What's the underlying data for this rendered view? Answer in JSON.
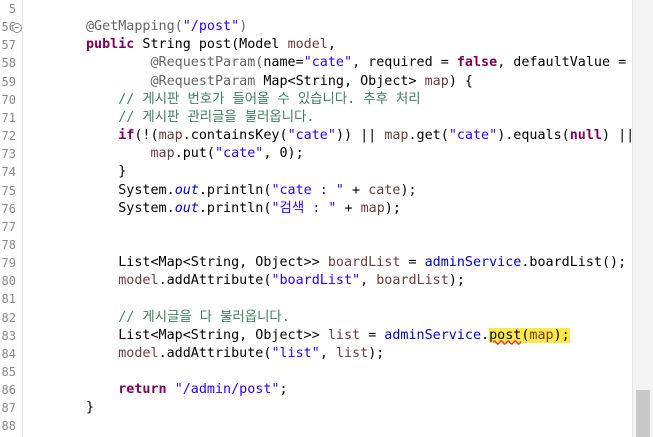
{
  "editor": {
    "line_numbers": [
      "5",
      "56",
      "57",
      "58",
      "59",
      "70",
      "71",
      "72",
      "73",
      "74",
      "75",
      "76",
      "77",
      "78",
      "79",
      "80",
      "81",
      "82",
      "83",
      "84",
      "85",
      "86",
      "87",
      "88"
    ],
    "fold_marker": "−",
    "highlight_color": "#ffe94a",
    "lines": [
      [],
      [
        {
          "t": "@GetMapping(",
          "c": "ann"
        },
        {
          "t": "\"/post\"",
          "c": "str"
        },
        {
          "t": ")",
          "c": "ann"
        }
      ],
      [
        {
          "t": "public",
          "c": "kw"
        },
        {
          "t": " String post(Model "
        },
        {
          "t": "model",
          "c": "var"
        },
        {
          "t": ","
        }
      ],
      [
        {
          "t": "        "
        },
        {
          "t": "@RequestParam(",
          "c": "ann"
        },
        {
          "t": "name="
        },
        {
          "t": "\"cate\"",
          "c": "str"
        },
        {
          "t": ", required = "
        },
        {
          "t": "false",
          "c": "kw"
        },
        {
          "t": ", defaultValue = "
        }
      ],
      [
        {
          "t": "        "
        },
        {
          "t": "@RequestParam",
          "c": "ann"
        },
        {
          "t": " Map<String, Object> "
        },
        {
          "t": "map",
          "c": "var"
        },
        {
          "t": ") {"
        }
      ],
      [
        {
          "t": "    "
        },
        {
          "t": "// 게시판 번호가 들어올 수 있습니다. 추후 처리",
          "c": "cmt"
        }
      ],
      [
        {
          "t": "    "
        },
        {
          "t": "// 게시판 관리글을 불러옵니다.",
          "c": "cmt"
        }
      ],
      [
        {
          "t": "    "
        },
        {
          "t": "if",
          "c": "kw"
        },
        {
          "t": "(!("
        },
        {
          "t": "map",
          "c": "var"
        },
        {
          "t": ".containsKey("
        },
        {
          "t": "\"cate\"",
          "c": "str"
        },
        {
          "t": ")) || "
        },
        {
          "t": "map",
          "c": "var"
        },
        {
          "t": ".get("
        },
        {
          "t": "\"cate\"",
          "c": "str"
        },
        {
          "t": ").equals("
        },
        {
          "t": "null",
          "c": "kw"
        },
        {
          "t": ") ||"
        }
      ],
      [
        {
          "t": "        "
        },
        {
          "t": "map",
          "c": "var"
        },
        {
          "t": ".put("
        },
        {
          "t": "\"cate\"",
          "c": "str"
        },
        {
          "t": ", 0);"
        }
      ],
      [
        {
          "t": "    }"
        }
      ],
      [
        {
          "t": "    System."
        },
        {
          "t": "out",
          "c": "fld"
        },
        {
          "t": ".println("
        },
        {
          "t": "\"cate : \"",
          "c": "str"
        },
        {
          "t": " + "
        },
        {
          "t": "cate",
          "c": "var"
        },
        {
          "t": ");"
        }
      ],
      [
        {
          "t": "    System."
        },
        {
          "t": "out",
          "c": "fld"
        },
        {
          "t": ".println("
        },
        {
          "t": "\"검색 : \"",
          "c": "str"
        },
        {
          "t": " + "
        },
        {
          "t": "map",
          "c": "var"
        },
        {
          "t": ");"
        }
      ],
      [],
      [],
      [
        {
          "t": "    List<Map<String, Object>> "
        },
        {
          "t": "boardList",
          "c": "var"
        },
        {
          "t": " = "
        },
        {
          "t": "adminService",
          "c": "fld2"
        },
        {
          "t": ".boardList();"
        }
      ],
      [
        {
          "t": "    "
        },
        {
          "t": "model",
          "c": "var"
        },
        {
          "t": ".addAttribute("
        },
        {
          "t": "\"boardList\"",
          "c": "str"
        },
        {
          "t": ", "
        },
        {
          "t": "boardList",
          "c": "var"
        },
        {
          "t": ");"
        }
      ],
      [],
      [
        {
          "t": "    "
        },
        {
          "t": "// 게시글을 다 불러옵니다.",
          "c": "cmt"
        }
      ],
      [
        {
          "t": "    List<Map<String, Object>> "
        },
        {
          "t": "list",
          "c": "var"
        },
        {
          "t": " = "
        },
        {
          "t": "adminService",
          "c": "fld2"
        },
        {
          "t": "."
        },
        {
          "t": "post",
          "c": "hl err"
        },
        {
          "t": "(",
          "c": "hl"
        },
        {
          "t": "map",
          "c": "hl var"
        },
        {
          "t": ");",
          "c": "hl"
        }
      ],
      [
        {
          "t": "    "
        },
        {
          "t": "model",
          "c": "var"
        },
        {
          "t": ".addAttribute("
        },
        {
          "t": "\"list\"",
          "c": "str"
        },
        {
          "t": ", "
        },
        {
          "t": "list",
          "c": "var"
        },
        {
          "t": ");"
        }
      ],
      [],
      [
        {
          "t": "    "
        },
        {
          "t": "return",
          "c": "kw"
        },
        {
          "t": " "
        },
        {
          "t": "\"/admin/post\"",
          "c": "str"
        },
        {
          "t": ";"
        }
      ],
      [
        {
          "t": "}"
        }
      ],
      []
    ]
  }
}
